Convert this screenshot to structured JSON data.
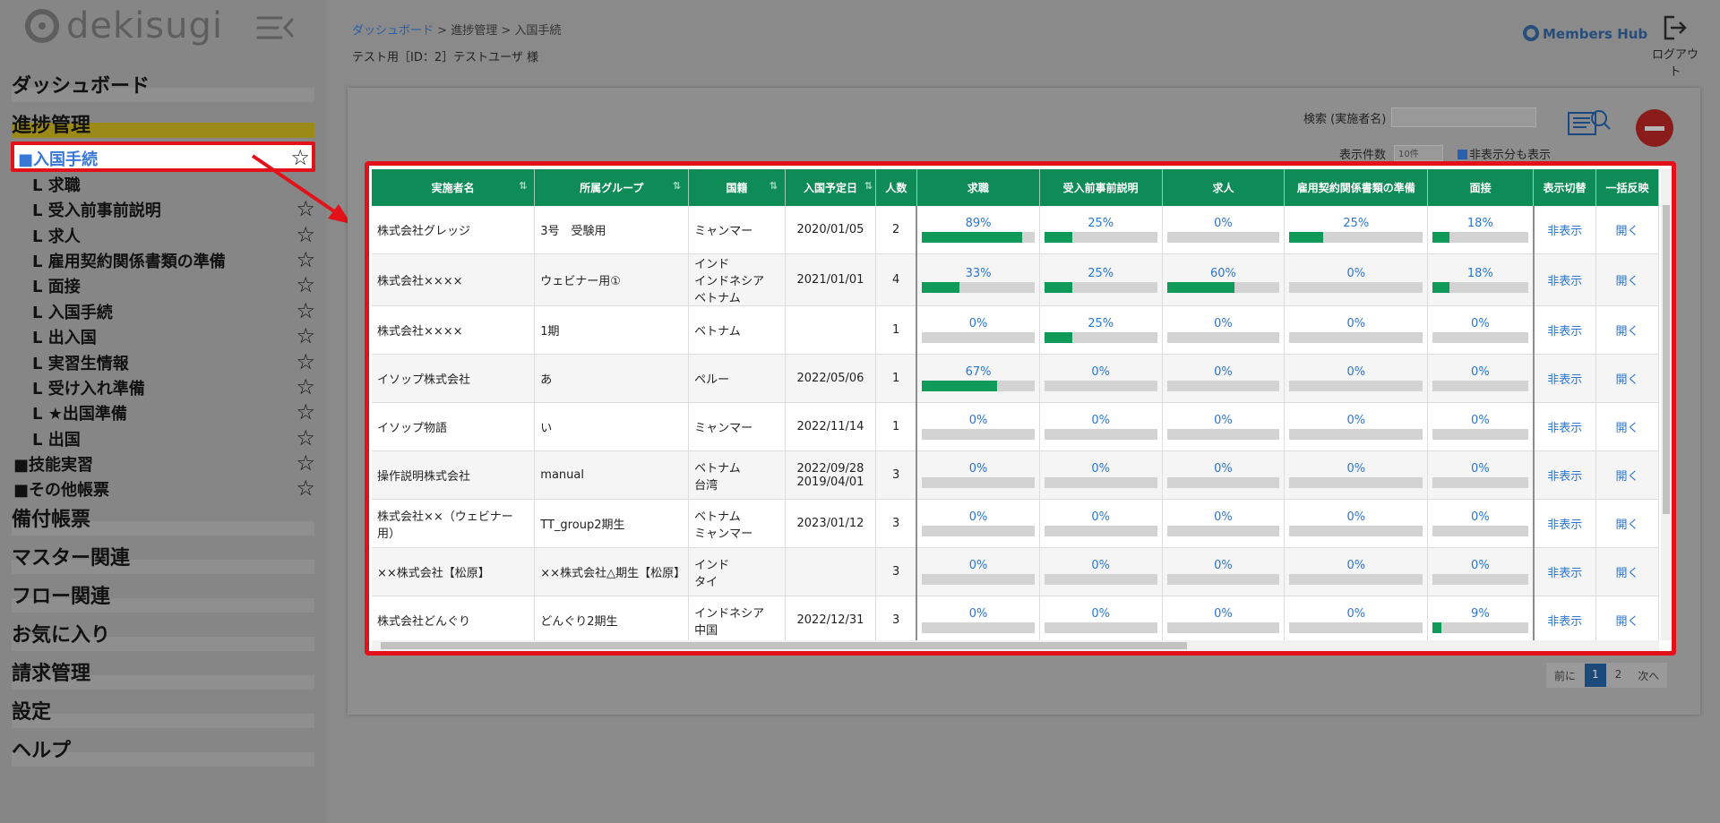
{
  "sidebar": {
    "logo": "dekisugi",
    "headings": {
      "dashboard": "ダッシュボード",
      "progress": "進捗管理",
      "equipment": "備付帳票",
      "master": "マスター関連",
      "flow": "フロー関連",
      "favorites": "お気に入り",
      "billing": "請求管理",
      "settings": "設定",
      "help": "ヘルプ"
    },
    "active_item": "■入国手続",
    "items": [
      "L 求職",
      "L 受入前事前説明",
      "L 求人",
      "L 雇用契約関係書類の準備",
      "L 面接",
      "L 入国手続",
      "L 出入国",
      "L 実習生情報",
      "L 受け入れ準備",
      "L ★出国準備",
      "L 出国"
    ],
    "groups": [
      "■技能実習",
      "■その他帳票"
    ]
  },
  "breadcrumb": {
    "home": "ダッシュボード",
    "sep1": ">",
    "mid": "進捗管理",
    "sep2": ">",
    "current": "入国手続"
  },
  "user_line": "テスト用［ID：2］テストユーザ 様",
  "brand": "Members Hub",
  "logout_label": "ログアウト",
  "search": {
    "label": "検索 (実施者名)",
    "value": ""
  },
  "count": {
    "label": "表示件数",
    "value": "10件"
  },
  "hidden_toggle": "非表示分も表示",
  "table": {
    "headers": [
      "実施者名",
      "所属グループ",
      "国籍",
      "入国予定日",
      "人数",
      "求職",
      "受入前事前説明",
      "求人",
      "雇用契約関係書類の準備",
      "面接",
      "表示切替",
      "一括反映"
    ],
    "action_hide": "非表示",
    "action_open": "開く",
    "rows": [
      {
        "name": "株式会社グレッジ",
        "group": "3号　受験用",
        "nationality": [
          "ミャンマー"
        ],
        "date": [
          "2020/01/05"
        ],
        "count": "2",
        "progress": [
          89,
          25,
          0,
          25,
          18
        ]
      },
      {
        "name": "株式会社××××",
        "group": "ウェビナー用①",
        "nationality": [
          "インド",
          "インドネシア",
          "ベトナム"
        ],
        "date": [
          "2021/01/01"
        ],
        "count": "4",
        "progress": [
          33,
          25,
          60,
          0,
          18
        ]
      },
      {
        "name": "株式会社××××",
        "group": "1期",
        "nationality": [
          "ベトナム"
        ],
        "date": [
          ""
        ],
        "count": "1",
        "progress": [
          0,
          25,
          0,
          0,
          0
        ]
      },
      {
        "name": "イソップ株式会社",
        "group": "あ",
        "nationality": [
          "ペルー"
        ],
        "date": [
          "2022/05/06"
        ],
        "count": "1",
        "progress": [
          67,
          0,
          0,
          0,
          0
        ]
      },
      {
        "name": "イソップ物語",
        "group": "い",
        "nationality": [
          "ミャンマー"
        ],
        "date": [
          "2022/11/14"
        ],
        "count": "1",
        "progress": [
          0,
          0,
          0,
          0,
          0
        ]
      },
      {
        "name": "操作説明株式会社",
        "group": "manual",
        "nationality": [
          "ベトナム",
          "台湾"
        ],
        "date": [
          "2022/09/28",
          "2019/04/01"
        ],
        "count": "3",
        "progress": [
          0,
          0,
          0,
          0,
          0
        ]
      },
      {
        "name": "株式会社××（ウェビナー用）",
        "group": "TT_group2期生",
        "nationality": [
          "ベトナム",
          "ミャンマー"
        ],
        "date": [
          "2023/01/12"
        ],
        "count": "3",
        "progress": [
          0,
          0,
          0,
          0,
          0
        ]
      },
      {
        "name": "××株式会社【松原】",
        "group": "××株式会社△期生【松原】",
        "nationality": [
          "インド",
          "タイ"
        ],
        "date": [
          ""
        ],
        "count": "3",
        "progress": [
          0,
          0,
          0,
          0,
          0
        ]
      },
      {
        "name": "株式会社どんぐり",
        "group": "どんぐり2期生",
        "nationality": [
          "インドネシア",
          "中国"
        ],
        "date": [
          "2022/12/31"
        ],
        "count": "3",
        "progress": [
          0,
          0,
          0,
          0,
          9
        ]
      }
    ]
  },
  "pagination": {
    "prev": "前に",
    "pages": [
      "1",
      "2"
    ],
    "next": "次へ"
  },
  "colors": {
    "header_green": "#0f8b58",
    "progress_fill": "#0f9a5a",
    "highlight_red": "#e3121a",
    "link_blue": "#2b76d2"
  }
}
